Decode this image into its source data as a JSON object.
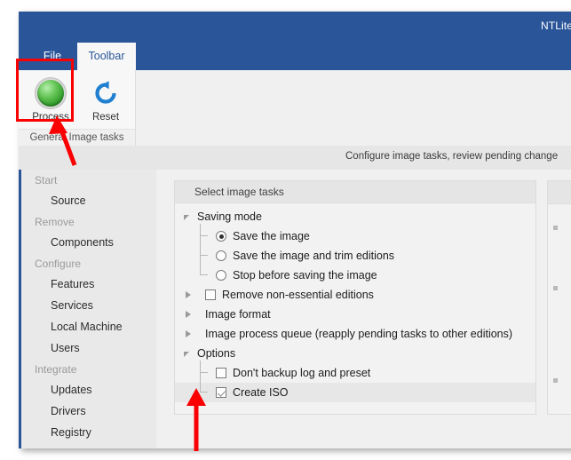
{
  "window": {
    "title": "NTLite",
    "description_bar": "Configure image tasks, review pending change"
  },
  "ribbon": {
    "tabs": [
      {
        "id": "file",
        "label": "File",
        "active": false
      },
      {
        "id": "toolbar",
        "label": "Toolbar",
        "active": true
      }
    ],
    "group_label": "General Image tasks",
    "buttons": [
      {
        "id": "process",
        "label": "Process",
        "icon": "green-led-icon"
      },
      {
        "id": "reset",
        "label": "Reset",
        "icon": "refresh-circular-arrow-icon"
      }
    ]
  },
  "sidebar": {
    "sections": [
      {
        "header": "Start",
        "items": [
          "Source"
        ]
      },
      {
        "header": "Remove",
        "items": [
          "Components"
        ]
      },
      {
        "header": "Configure",
        "items": [
          "Features",
          "Services",
          "Local Machine",
          "Users"
        ]
      },
      {
        "header": "Integrate",
        "items": [
          "Updates",
          "Drivers",
          "Registry"
        ]
      }
    ]
  },
  "tree_panel": {
    "header": "Select image tasks",
    "nodes": [
      {
        "id": "saving-mode",
        "label": "Saving mode",
        "expander": "expanded",
        "control": "none",
        "children": [
          {
            "id": "save-the-image",
            "label": "Save the image",
            "control": "radio",
            "checked": true
          },
          {
            "id": "save-trim-editions",
            "label": "Save the image and trim editions",
            "control": "radio",
            "checked": false
          },
          {
            "id": "stop-before-saving",
            "label": "Stop before saving the image",
            "control": "radio",
            "checked": false
          }
        ]
      },
      {
        "id": "remove-non-essential-editions",
        "label": "Remove non-essential editions",
        "expander": "collapsed",
        "control": "checkbox",
        "checked": false,
        "children": []
      },
      {
        "id": "image-format",
        "label": "Image format",
        "expander": "collapsed",
        "control": "none",
        "children": []
      },
      {
        "id": "image-process-queue",
        "label": "Image process queue (reapply pending tasks to other editions)",
        "expander": "collapsed",
        "control": "none",
        "children": []
      },
      {
        "id": "options",
        "label": "Options",
        "expander": "expanded",
        "control": "none",
        "children": [
          {
            "id": "dont-backup-log-preset",
            "label": "Don't backup log and preset",
            "control": "checkbox",
            "checked": false
          },
          {
            "id": "create-iso",
            "label": "Create ISO",
            "control": "checkbox",
            "checked": true,
            "selected": true
          }
        ]
      }
    ]
  },
  "annotations": {
    "highlight_color": "#fa0000",
    "process_button_box": "red rectangle around Process button",
    "arrow_to_process": "red arrow pointing up-left at Process button",
    "arrow_to_create_iso": "red arrow pointing up at Create ISO checkbox"
  },
  "colors": {
    "titlebar_blue": "#2a5699",
    "accent_blue": "#2a5699",
    "annotation_red": "#fa0000",
    "led_green": "#3faa35"
  }
}
